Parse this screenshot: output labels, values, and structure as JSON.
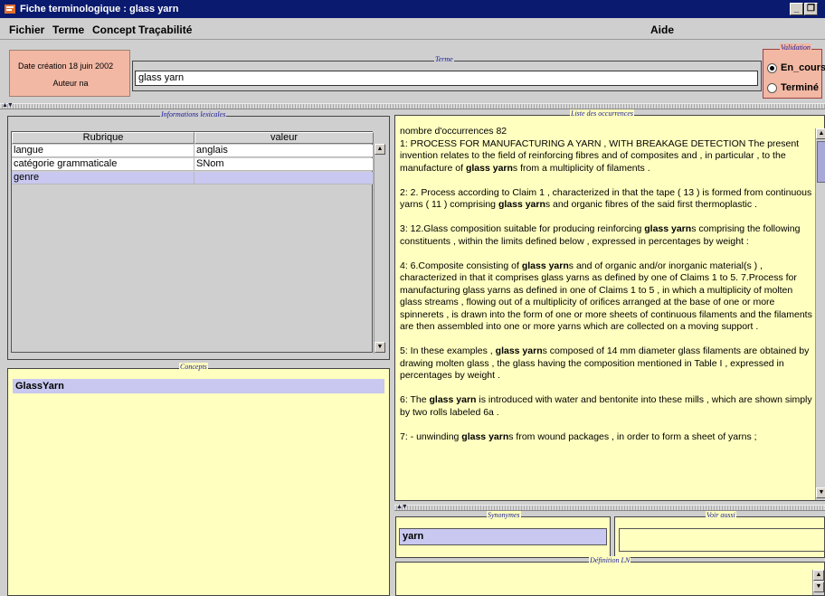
{
  "window": {
    "title": "Fiche terminologique : glass yarn",
    "buttons": {
      "minimize": "_",
      "maximize": "❐"
    }
  },
  "menu": {
    "items": [
      "Fichier",
      "Terme",
      "Concept",
      "Traçabilité"
    ],
    "help": "Aide"
  },
  "header": {
    "date_creation": "Date création 18 juin 2002",
    "auteur": "Auteur na",
    "terme_title": "Terme",
    "terme_value": "glass yarn",
    "validation_title": "Validation",
    "validation_options": [
      "En_cours",
      "Terminé"
    ],
    "validation_selected": "En_cours"
  },
  "lexical": {
    "title": "Informations lexicales",
    "columns": [
      "Rubrique",
      "valeur"
    ],
    "rows": [
      {
        "rubrique": "langue",
        "valeur": "anglais"
      },
      {
        "rubrique": "catégorie grammaticale",
        "valeur": "SNom"
      },
      {
        "rubrique": "genre",
        "valeur": ""
      }
    ],
    "selected_row": 2
  },
  "concepts": {
    "title": "Concepts",
    "items": [
      "GlassYarn"
    ]
  },
  "occurrences": {
    "title": "Liste des occurrences",
    "count_label": "nombre d'occurrences 82",
    "term": "glass yarn",
    "entries": [
      {
        "before": " 1: PROCESS FOR MANUFACTURING A YARN , WITH BREAKAGE DETECTION The present invention relates to the field of reinforcing fibres and of composites and , in particular , to the manufacture of ",
        "term": "glass yarn",
        "after": "s from a multiplicity of filaments ."
      },
      {
        "before": " 2: 2. Process according to Claim 1 , characterized in that the tape ( 13 ) is formed from continuous yarns ( 11 ) comprising ",
        "term": "glass yarn",
        "after": "s and organic fibres of the said first thermoplastic ."
      },
      {
        "before": " 3: 12.Glass composition suitable for producing reinforcing ",
        "term": "glass yarn",
        "after": "s comprising the following constituents , within the limits defined below , expressed in percentages by weight :"
      },
      {
        "before": " 4: 6.Composite consisting of ",
        "term": "glass yarn",
        "after": "s and of organic and/or inorganic material(s ) , characterized in that it comprises glass yarns as defined by one of Claims 1 to 5. 7.Process for manufacturing glass yarns as defined in one of Claims 1 to 5 , in which a multiplicity of molten glass streams , flowing out of a multiplicity of orifices arranged at the base of one or more spinnerets , is drawn into the form of one or more sheets of continuous filaments and the filaments are then assembled into one or more yarns which are collected on a moving support ."
      },
      {
        "before": " 5: In these examples , ",
        "term": "glass yarn",
        "after": "s composed of 14 mm diameter glass filaments are obtained by drawing molten glass , the glass having the composition mentioned in Table I , expressed in percentages by weight ."
      },
      {
        "before": " 6: The ",
        "term": "glass yarn",
        "after": " is introduced with water and bentonite into these mills , which are shown simply by two rolls labeled 6a ."
      },
      {
        "before": " 7: - unwinding ",
        "term": "glass yarn",
        "after": "s from wound packages , in order to form a sheet of yarns ;"
      }
    ]
  },
  "synonymes": {
    "title": "Synonymes",
    "items": [
      "yarn"
    ]
  },
  "voir_aussi": {
    "title": "Voir aussi",
    "items": []
  },
  "definition": {
    "title": "Définition LN",
    "text": ""
  },
  "colors": {
    "titlebar": "#0a1a6e",
    "panel_yellow": "#ffffc0",
    "selection": "#c8c8f0",
    "header_pink": "#f2b8a4",
    "group_title": "#1a1a9a"
  }
}
